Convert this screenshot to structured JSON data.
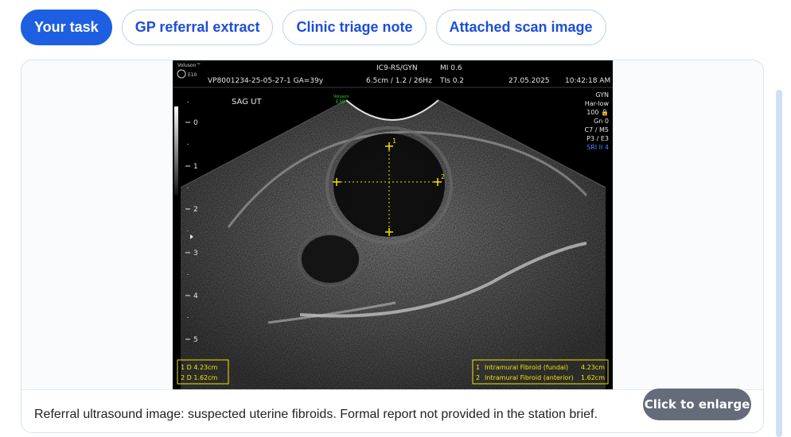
{
  "tabs": [
    {
      "label": "Your task",
      "active": true
    },
    {
      "label": "GP referral extract",
      "active": false
    },
    {
      "label": "Clinic triage note",
      "active": false
    },
    {
      "label": "Attached scan image",
      "active": false
    }
  ],
  "scan": {
    "brand_line1": "Voluson™",
    "brand_line2": "E10",
    "patient_id": "VP8001234-25-05-27-1  GA=39y",
    "probe": "IC9-RS/GYN",
    "mi": "MI  0.6",
    "params": "6.5cm / 1.2 / 26Hz",
    "tis": "TIs  0.2",
    "date": "27.05.2025",
    "time": "10:42:18 AM",
    "view": "SAG UT",
    "logo_line1": "Voluson",
    "logo_line2": "E30",
    "side_settings": [
      "GYN",
      "Har-low",
      "100 🔒",
      "Gn  0",
      "C7 / M5",
      "P3 / E3"
    ],
    "side_settings_highlight": "SRI II 4",
    "depth_ticks": [
      "0",
      "1",
      "2",
      "3",
      "4",
      "5"
    ],
    "measurements_left": [
      "1   D 4.23cm",
      "2   D 1.62cm"
    ],
    "measurements_right": [
      {
        "num": "1",
        "label": "Intramural Fibroid (fundal)",
        "value": "4.23cm"
      },
      {
        "num": "2",
        "label": "Intramural Fibroid (anterior)",
        "value": "1.62cm"
      }
    ],
    "marker1": "1",
    "marker2": "2"
  },
  "caption": "Referral ultrasound image: suspected uterine fibroids. Formal report not provided in the station brief.",
  "enlarge_label": "Click to enlarge",
  "colors": {
    "accent": "#1d5fe0",
    "tab_border": "#bcd3f3",
    "caliper": "#f2e500",
    "highlight": "#5a7dff"
  }
}
